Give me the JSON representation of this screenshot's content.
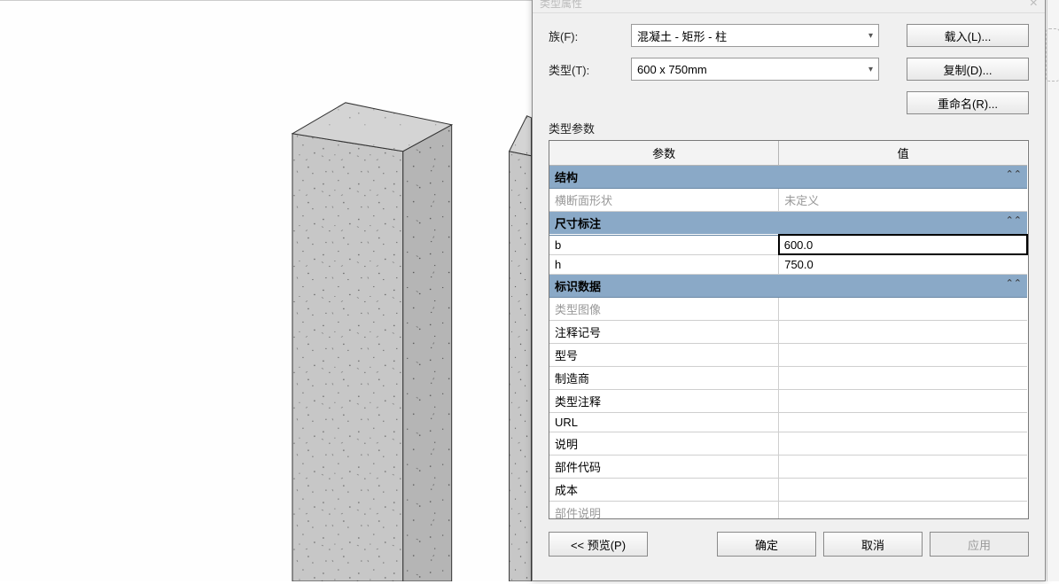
{
  "dialog": {
    "title": "类型属性",
    "family_label": "族(F):",
    "family_value": "混凝土 - 矩形 - 柱",
    "type_label": "类型(T):",
    "type_value": "600 x 750mm",
    "load_btn": "载入(L)...",
    "duplicate_btn": "复制(D)...",
    "rename_btn": "重命名(R)...",
    "section_title": "类型参数",
    "header_param": "参数",
    "header_value": "值",
    "groups": [
      {
        "name": "结构",
        "rows": [
          {
            "label": "横断面形状",
            "value": "未定义",
            "disabled": true
          }
        ]
      },
      {
        "name": "尺寸标注",
        "rows": [
          {
            "label": "b",
            "value": "600.0",
            "selected": true
          },
          {
            "label": "h",
            "value": "750.0"
          }
        ]
      },
      {
        "name": "标识数据",
        "rows": [
          {
            "label": "类型图像",
            "value": "",
            "disabled": true
          },
          {
            "label": "注释记号",
            "value": ""
          },
          {
            "label": "型号",
            "value": ""
          },
          {
            "label": "制造商",
            "value": ""
          },
          {
            "label": "类型注释",
            "value": ""
          },
          {
            "label": "URL",
            "value": ""
          },
          {
            "label": "说明",
            "value": ""
          },
          {
            "label": "部件代码",
            "value": ""
          },
          {
            "label": "成本",
            "value": ""
          },
          {
            "label": "部件说明",
            "value": "",
            "disabled": true
          }
        ]
      }
    ],
    "preview_btn": "<< 预览(P)",
    "ok_btn": "确定",
    "cancel_btn": "取消",
    "apply_btn": "应用"
  }
}
